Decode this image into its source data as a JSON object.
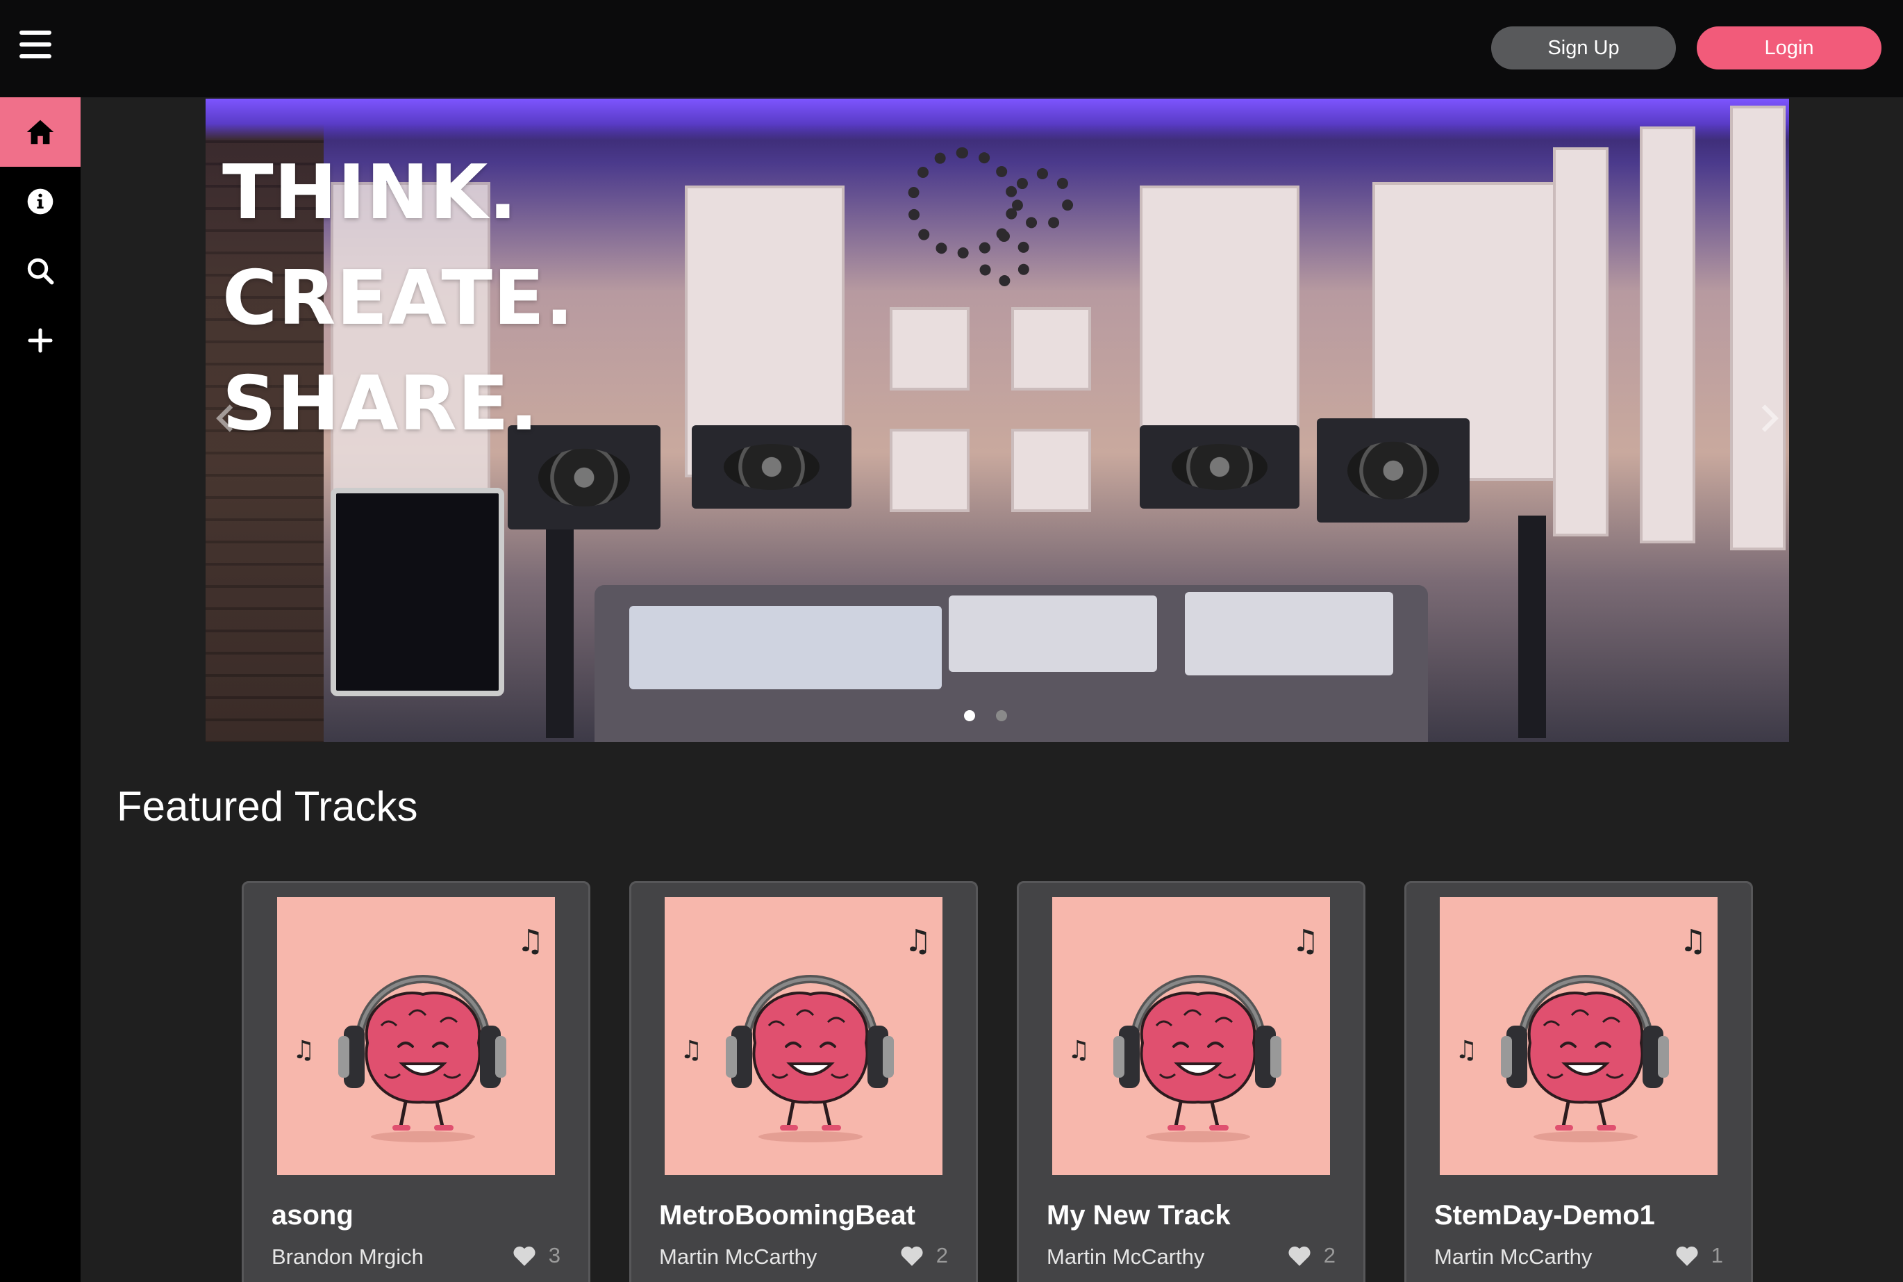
{
  "header": {
    "signup_label": "Sign Up",
    "login_label": "Login"
  },
  "sidebar": {
    "items": [
      {
        "name": "home",
        "icon": "home-icon",
        "active": true
      },
      {
        "name": "about",
        "icon": "info-icon",
        "active": false
      },
      {
        "name": "search",
        "icon": "search-icon",
        "active": false
      },
      {
        "name": "create",
        "icon": "plus-icon",
        "active": false
      }
    ]
  },
  "hero": {
    "line1": "THINK.",
    "line2": "CREATE.",
    "line3": "SHARE.",
    "slide_count": 2,
    "active_slide": 1
  },
  "featured": {
    "title": "Featured Tracks",
    "tracks": [
      {
        "title": "asong",
        "author": "Brandon Mrgich",
        "likes": "3"
      },
      {
        "title": "MetroBoomingBeat",
        "author": "Martin McCarthy",
        "likes": "2"
      },
      {
        "title": "My New Track",
        "author": "Martin McCarthy",
        "likes": "2"
      },
      {
        "title": "StemDay-Demo1",
        "author": "Martin McCarthy",
        "likes": "1"
      }
    ]
  },
  "colors": {
    "accent": "#f25b7a",
    "sidebar_active": "#f0708a",
    "topbar": "#0b0b0c",
    "background": "#1f1f1f",
    "card": "#444446",
    "art_bg": "#f7b7ac"
  }
}
